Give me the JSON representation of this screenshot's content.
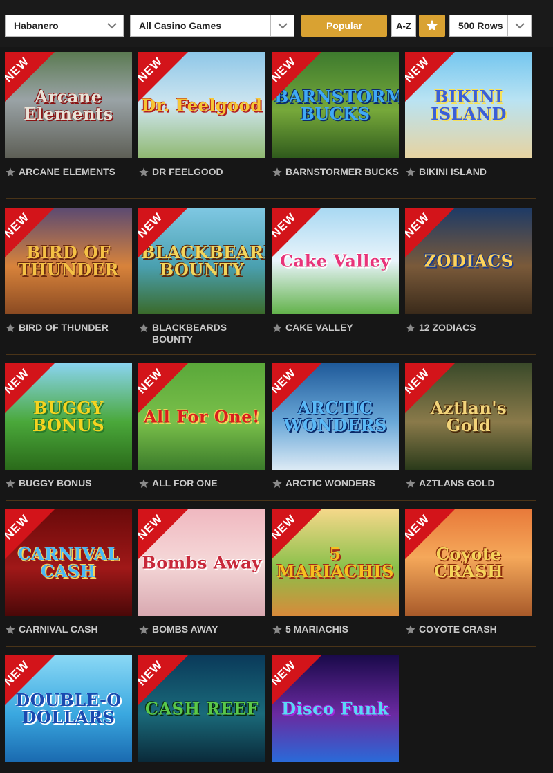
{
  "filters": {
    "provider": "Habanero",
    "category": "All Casino Games",
    "sort_popular": "Popular",
    "sort_az": "A-Z",
    "rows": "500 Rows"
  },
  "badge_text": "NEW",
  "colors": {
    "accent": "#d9a232",
    "badge": "#d3141a",
    "background": "#161616",
    "divider": "#4a3418"
  },
  "games": [
    {
      "name": "ARCANE ELEMENTS",
      "logo": "Arcane Elements",
      "bg": "linear-gradient(180deg,#5b7a52 0%,#9aa3a6 45%,#5d5e55 100%)",
      "logo_color": "#e9e3d8",
      "logo_shadow": "#8a1414"
    },
    {
      "name": "DR FEELGOOD",
      "logo": "Dr. Feelgood",
      "bg": "linear-gradient(180deg,#8ec7e8 0%,#cfe6f0 50%,#8fb870 100%)",
      "logo_color": "#f6c635",
      "logo_shadow": "#b31e1e"
    },
    {
      "name": "BARNSTORMER BUCKS",
      "logo": "BARNSTORMER BUCKS",
      "bg": "linear-gradient(180deg,#3d7a2e 0%,#76a83a 55%,#2f5a1c 100%)",
      "logo_color": "#3fa9f5",
      "logo_shadow": "#0b2a6a"
    },
    {
      "name": "BIKINI ISLAND",
      "logo": "BIKINI ISLAND",
      "bg": "linear-gradient(180deg,#74c6ef 0%,#b9e3f3 45%,#e7d3a0 100%)",
      "logo_color": "#3a5fd8",
      "logo_shadow": "#f7e15a"
    },
    {
      "name": "BIRD OF THUNDER",
      "logo": "BIRD OF THUNDER",
      "bg": "linear-gradient(180deg,#5b4a72 0%,#d8833b 55%,#8a4a22 100%)",
      "logo_color": "#f4c045",
      "logo_shadow": "#6a2a10"
    },
    {
      "name": "BLACKBEARDS BOUNTY",
      "logo": "BLACKBEARD'S BOUNTY",
      "bg": "linear-gradient(180deg,#7fc8e3 0%,#4aa0b0 55%,#3a6a2a 100%)",
      "logo_color": "#f3d55b",
      "logo_shadow": "#5a2a10"
    },
    {
      "name": "CAKE VALLEY",
      "logo": "Cake Valley",
      "bg": "linear-gradient(180deg,#a8d8f2 0%,#e9f4fb 50%,#62b24a 100%)",
      "logo_color": "#e8347a",
      "logo_shadow": "#ffffff"
    },
    {
      "name": "12 ZODIACS",
      "logo": "ZODIACS",
      "bg": "linear-gradient(180deg,#1d3a66 0%,#7a5a3a 55%,#3a2a1a 100%)",
      "logo_color": "#ffd35a",
      "logo_shadow": "#1a3a8a"
    },
    {
      "name": "BUGGY BONUS",
      "logo": "BUGGY BONUS",
      "bg": "linear-gradient(180deg,#8ad4f0 0%,#4aa83a 55%,#2a6a1a 100%)",
      "logo_color": "#f5d320",
      "logo_shadow": "#2a7a2a"
    },
    {
      "name": "ALL FOR ONE",
      "logo": "All For One!",
      "bg": "linear-gradient(180deg,#5aa83a 0%,#7ac04a 55%,#3a7a2a 100%)",
      "logo_color": "#d91e1e",
      "logo_shadow": "#f5d35a"
    },
    {
      "name": "ARCTIC WONDERS",
      "logo": "ARCTIC WONDERS",
      "bg": "linear-gradient(180deg,#1f5a9a 0%,#6aa8d8 55%,#dceaf5 100%)",
      "logo_color": "#5ab8f5",
      "logo_shadow": "#0a2a6a"
    },
    {
      "name": "AZTLANS GOLD",
      "logo": "Aztlan's Gold",
      "bg": "linear-gradient(180deg,#3a4a2a 0%,#8a7a4a 55%,#2a3a1a 100%)",
      "logo_color": "#f2d47a",
      "logo_shadow": "#4a2a0a"
    },
    {
      "name": "CARNIVAL CASH",
      "logo": "CARNIVAL CASH",
      "bg": "linear-gradient(180deg,#6a0a0a 0%,#a01818 55%,#4a0808 100%)",
      "logo_color": "#4ab8f5",
      "logo_shadow": "#f5d35a"
    },
    {
      "name": "BOMBS AWAY",
      "logo": "Bombs Away",
      "bg": "linear-gradient(180deg,#f0b8c0 0%,#f5d8d8 50%,#d8a8b0 100%)",
      "logo_color": "#c8283a",
      "logo_shadow": "#ffffff"
    },
    {
      "name": "5 MARIACHIS",
      "logo": "5 MARIACHIS",
      "bg": "linear-gradient(180deg,#f5d88a 0%,#8ac04a 55%,#d88a3a 100%)",
      "logo_color": "#f5c020",
      "logo_shadow": "#a02a1a"
    },
    {
      "name": "COYOTE CRASH",
      "logo": "Coyote CRASH",
      "bg": "linear-gradient(180deg,#e87a3a 0%,#f5a85a 45%,#a85a2a 100%)",
      "logo_color": "#f5d35a",
      "logo_shadow": "#8a2a0a"
    },
    {
      "name": "",
      "logo": "DOUBLE-O DOLLARS",
      "bg": "linear-gradient(180deg,#8ad8f5 0%,#3aa8e0 55%,#1a6ab0 100%)",
      "logo_color": "#1a4ab0",
      "logo_shadow": "#ffffff"
    },
    {
      "name": "",
      "logo": "CASH REEF",
      "bg": "linear-gradient(180deg,#0a3a5a 0%,#1a6a7a 55%,#0a2a3a 100%)",
      "logo_color": "#5ac84a",
      "logo_shadow": "#0a2a0a"
    },
    {
      "name": "",
      "logo": "Disco Funk",
      "bg": "linear-gradient(180deg,#1a0a4a 0%,#6a2aa0 55%,#2a6ad8 100%)",
      "logo_color": "#5ad8f5",
      "logo_shadow": "#a02ad8"
    }
  ]
}
